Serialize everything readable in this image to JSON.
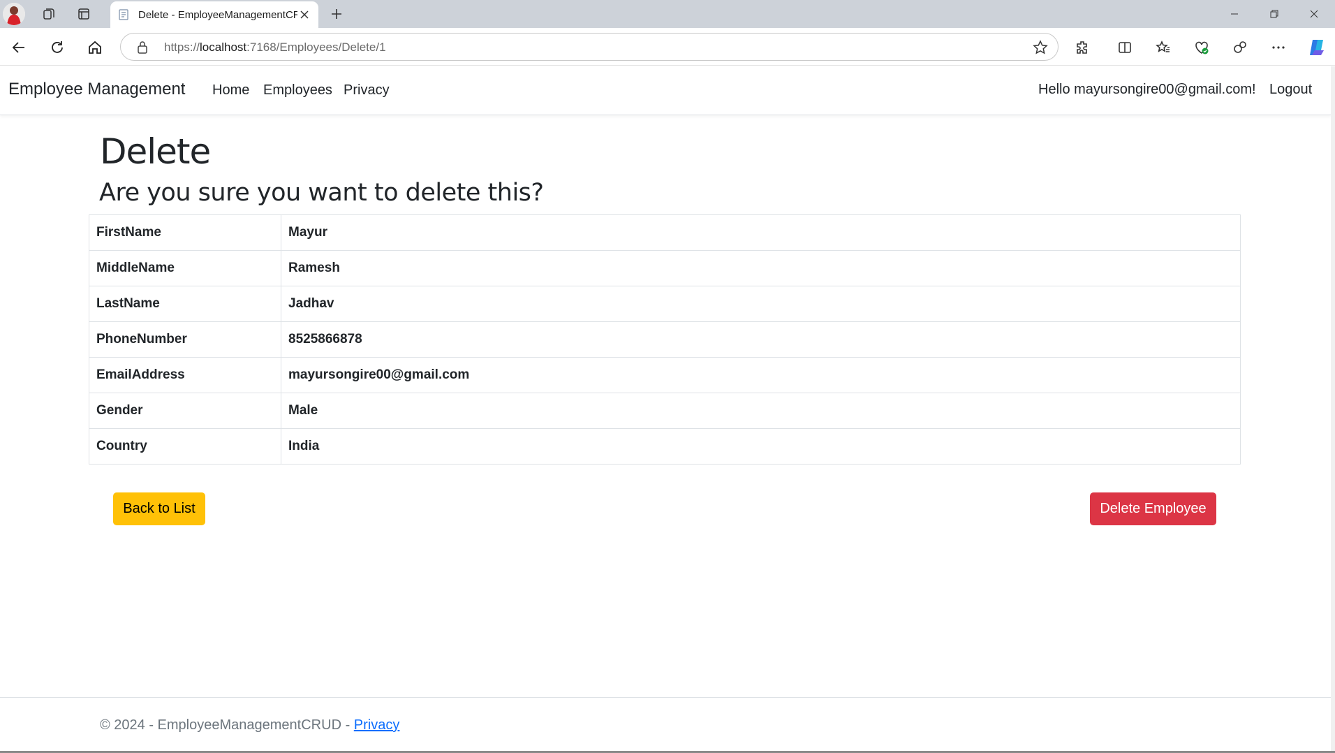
{
  "browser": {
    "tab_title": "Delete - EmployeeManagementCRUD",
    "url_prefix": "https://",
    "url_host": "localhost",
    "url_rest": ":7168/Employees/Delete/1"
  },
  "navbar": {
    "brand": "Employee Management",
    "links": [
      "Home",
      "Employees",
      "Privacy"
    ],
    "greeting": "Hello mayursongire00@gmail.com!",
    "logout": "Logout"
  },
  "page": {
    "title": "Delete",
    "subtitle": "Are you sure you want to delete this?"
  },
  "details": [
    {
      "label": "FirstName",
      "value": "Mayur"
    },
    {
      "label": "MiddleName",
      "value": "Ramesh"
    },
    {
      "label": "LastName",
      "value": "Jadhav"
    },
    {
      "label": "PhoneNumber",
      "value": "8525866878"
    },
    {
      "label": "EmailAddress",
      "value": "mayursongire00@gmail.com"
    },
    {
      "label": "Gender",
      "value": "Male"
    },
    {
      "label": "Country",
      "value": "India"
    }
  ],
  "actions": {
    "back": "Back to List",
    "delete": "Delete Employee"
  },
  "footer": {
    "copyright": "© 2024 - EmployeeManagementCRUD - ",
    "privacy": "Privacy"
  },
  "colors": {
    "warning": "#ffc107",
    "danger": "#dc3545",
    "link": "#0d6efd"
  }
}
